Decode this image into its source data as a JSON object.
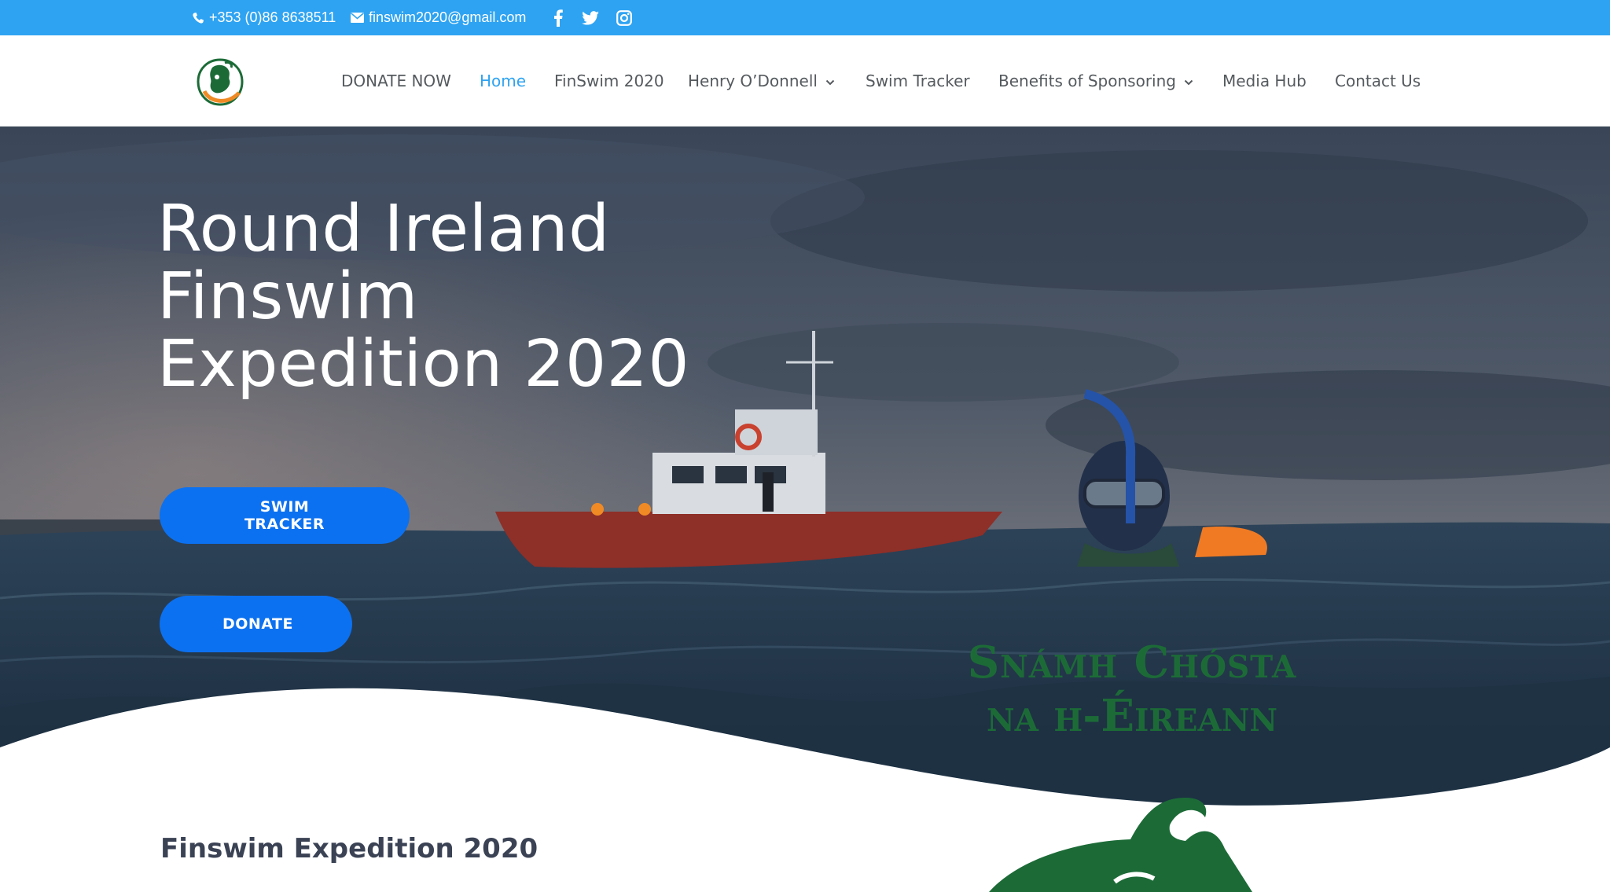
{
  "topbar": {
    "phone": "+353 (0)86 8638511",
    "email": "finswim2020@gmail.com",
    "social_icons": [
      "facebook-icon",
      "twitter-icon",
      "instagram-icon"
    ],
    "background": "#2ea3f2"
  },
  "nav": {
    "items": [
      {
        "label": "DONATE NOW"
      },
      {
        "label": "Home",
        "active": true
      },
      {
        "label": "FinSwim 2020"
      },
      {
        "label": "Henry O’Donnell",
        "has_dropdown": true
      },
      {
        "label": "Swim Tracker"
      },
      {
        "label": "Benefits of Sponsoring",
        "has_dropdown": true
      },
      {
        "label": "Media Hub"
      },
      {
        "label": "Contact Us"
      }
    ],
    "active_color": "#2ea3f2",
    "text_color": "#555a5e"
  },
  "hero": {
    "title_lines": [
      "Round Ireland",
      "Finswim",
      "Expedition 2020"
    ],
    "buttons": {
      "tracker": "SWIM TRACKER",
      "donate": "DONATE"
    },
    "button_color": "#0c71f0",
    "gaelic_line1": "Snámh Chósta",
    "gaelic_line2": "na h-Éireann"
  },
  "section": {
    "title": "Finswim Expedition 2020"
  }
}
